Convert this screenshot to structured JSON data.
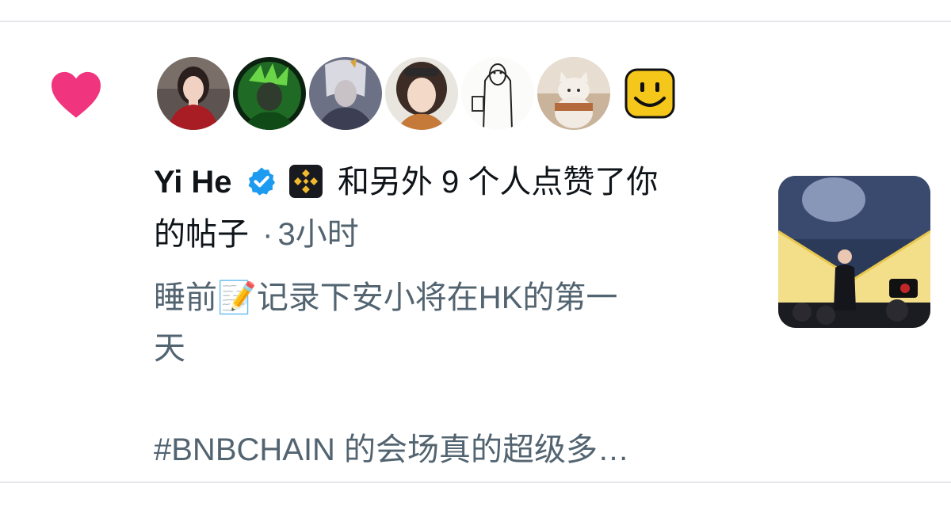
{
  "notification": {
    "type_icon": "heart-icon",
    "accent_color": "#f0357e",
    "actor_name": "Yi He",
    "verified_icon": "verified-badge-icon",
    "affiliate_icon": "binance-logo-icon",
    "action_line1": "和另外 9 个人点赞了你",
    "action_line2": "的帖子",
    "separator": "·",
    "time": "3小时",
    "post_line1_a": "睡前",
    "post_emoji": "📝",
    "post_line1_b": "记录下安小将在HK的第一",
    "post_line2": "天",
    "post_line3": "#BNBCHAIN 的会场真的超级多…",
    "avatar_icons": [
      "avatar-woman-red-dress",
      "avatar-green-warrior",
      "avatar-armored-knight",
      "avatar-anime-girl-goggles",
      "avatar-sketch-ghost",
      "avatar-cat-plush",
      "avatar-yellow-smiley"
    ]
  }
}
